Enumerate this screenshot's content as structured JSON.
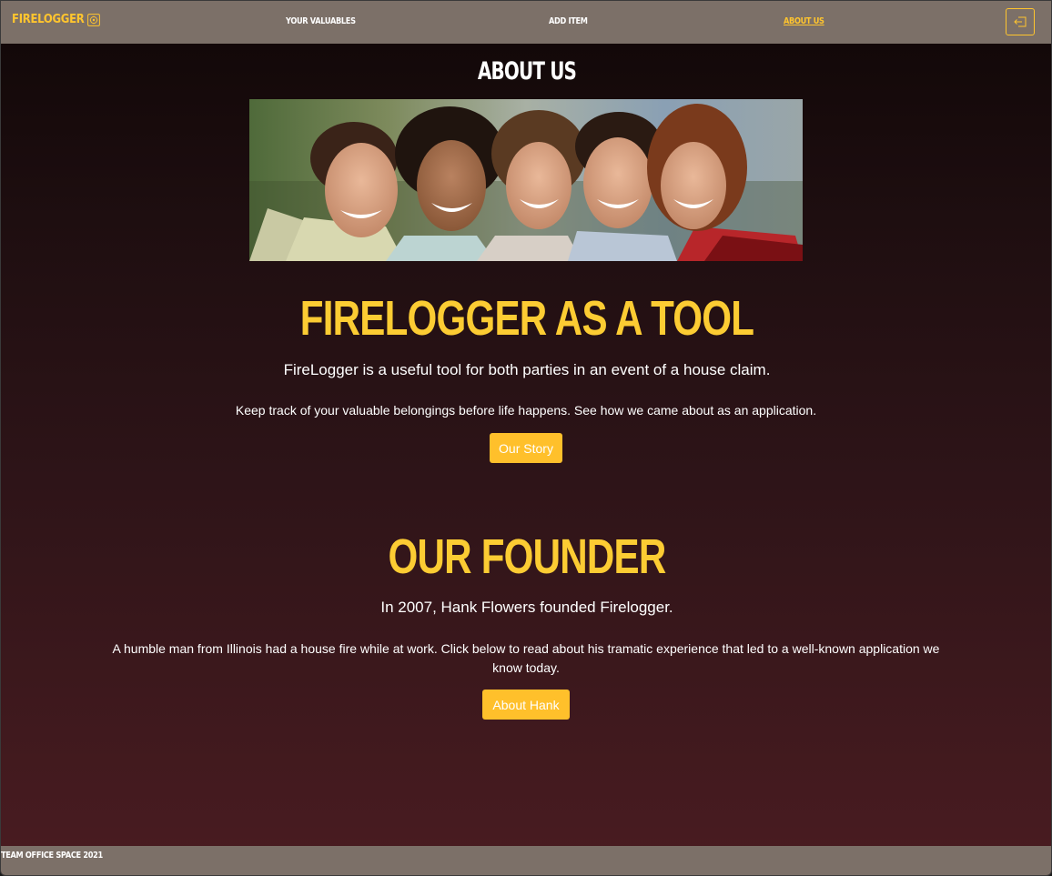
{
  "navbar": {
    "brand": "FIRELOGGER",
    "brand_icon": "safe-icon",
    "links": [
      {
        "label": "YOUR VALUABLES"
      },
      {
        "label": "ADD ITEM"
      },
      {
        "label": "ABOUT US",
        "active": true
      }
    ],
    "logout_icon": "sign-out-icon"
  },
  "page": {
    "title": "ABOUT US"
  },
  "tool_section": {
    "heading": "FIRELOGGER AS A TOOL",
    "lead": "FireLogger is a useful tool for both parties in an event of a house claim.",
    "body": "Keep track of your valuable belongings before life happens. See how we came about as an application.",
    "button": "Our Story"
  },
  "founder_section": {
    "heading": "OUR FOUNDER",
    "lead": "In 2007, Hank Flowers founded Firelogger.",
    "body": "A humble man from Illinois had a house fire while at work. Click below to read about his tramatic experience that led to a well-known application we know today.",
    "button": "About Hank"
  },
  "footer": {
    "text": "TEAM OFFICE SPACE 2021"
  },
  "colors": {
    "accent": "#ffc52e",
    "navbar_bg": "#7c7068",
    "heading_yellow": "#fccc33"
  }
}
